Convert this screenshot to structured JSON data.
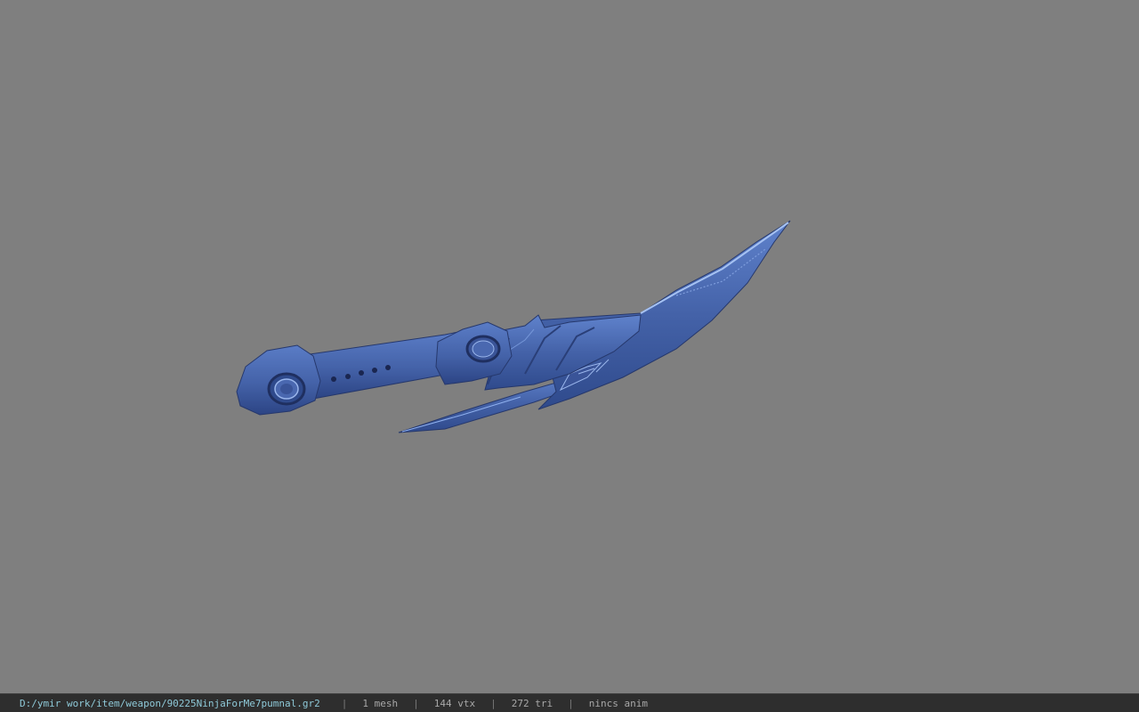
{
  "viewer": {
    "background_color": "#7f7f7f",
    "model_color": "#4462a8",
    "model_highlight_color": "#8fb0ee",
    "model_shadow_color": "#26386c"
  },
  "status_bar": {
    "file_path": "D:/ymir work/item/weapon/90225NinjaForMe7pumnal.gr2",
    "separator": "|",
    "mesh_count": "1 mesh",
    "vertex_count": "144 vtx",
    "triangle_count": "272 tri",
    "animation": "nincs anim"
  }
}
